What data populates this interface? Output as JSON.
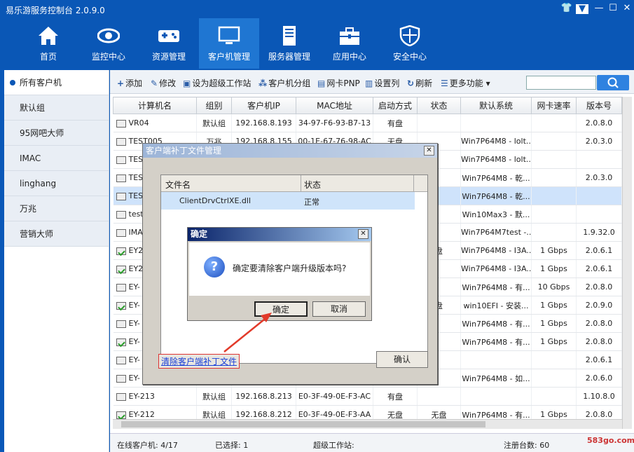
{
  "app": {
    "title": "易乐游服务控制台 2.0.9.0"
  },
  "nav": [
    {
      "label": "首页",
      "icon": "home-icon"
    },
    {
      "label": "监控中心",
      "icon": "eye-icon"
    },
    {
      "label": "资源管理",
      "icon": "gamepad-icon"
    },
    {
      "label": "客户机管理",
      "icon": "monitor-icon"
    },
    {
      "label": "服务器管理",
      "icon": "server-icon"
    },
    {
      "label": "应用中心",
      "icon": "toolbox-icon"
    },
    {
      "label": "安全中心",
      "icon": "shield-icon"
    }
  ],
  "sidebar": {
    "items": [
      {
        "label": "所有客户机"
      },
      {
        "label": "默认组"
      },
      {
        "label": "95网吧大师"
      },
      {
        "label": "IMAC"
      },
      {
        "label": "linghang"
      },
      {
        "label": "万兆"
      },
      {
        "label": "营销大师"
      }
    ]
  },
  "toolbar": {
    "add": "添加",
    "edit": "修改",
    "superws": "设为超级工作站",
    "group": "客户机分组",
    "pnp": "网卡PNP",
    "columns": "设置列",
    "refresh": "刷新",
    "more": "更多功能"
  },
  "table": {
    "headers": [
      "计算机名",
      "组别",
      "客户机IP",
      "MAC地址",
      "启动方式",
      "状态",
      "默认系统",
      "网卡速率",
      "版本号"
    ],
    "rows": [
      [
        "VR04",
        "默认组",
        "192.168.8.193",
        "34-97-F6-93-B7-13",
        "有盘",
        "",
        "",
        "",
        "2.0.8.0"
      ],
      [
        "TEST005",
        "万兆",
        "192.168.8.155",
        "00-1E-67-76-98-AC",
        "无盘",
        "",
        "Win7P64M8 - lolt...",
        "",
        "2.0.3.0"
      ],
      [
        "TES",
        "",
        "",
        "",
        "",
        "",
        "Win7P64M8 - lolt...",
        "",
        ""
      ],
      [
        "TES",
        "",
        "",
        "",
        "",
        "",
        "Win7P64M8 - 乾...",
        "",
        "2.0.3.0"
      ],
      [
        "TES",
        "",
        "",
        "",
        "",
        "",
        "Win7P64M8 - 乾...",
        "",
        ""
      ],
      [
        "test",
        "",
        "",
        "",
        "",
        "",
        "Win10Max3 - 默...",
        "",
        ""
      ],
      [
        "IMA",
        "",
        "",
        "",
        "",
        "",
        "Win7P64M7test -...",
        "",
        "1.9.32.0"
      ],
      [
        "EY2",
        "",
        "",
        "",
        "",
        "盘",
        "Win7P64M8 - I3A...",
        "1 Gbps",
        "2.0.6.1"
      ],
      [
        "EY2",
        "",
        "",
        "",
        "",
        "",
        "Win7P64M8 - I3A...",
        "1 Gbps",
        "2.0.6.1"
      ],
      [
        "EY-",
        "",
        "",
        "",
        "",
        "",
        "Win7P64M8 - 有...",
        "10 Gbps",
        "2.0.8.0"
      ],
      [
        "EY-",
        "",
        "",
        "",
        "",
        "盘",
        "win10EFI - 安装...",
        "1 Gbps",
        "2.0.9.0"
      ],
      [
        "EY-",
        "",
        "",
        "",
        "",
        "",
        "Win7P64M8 - 有...",
        "1 Gbps",
        "2.0.8.0"
      ],
      [
        "EY-",
        "",
        "",
        "",
        "",
        "",
        "Win7P64M8 - 有...",
        "1 Gbps",
        "2.0.8.0"
      ],
      [
        "EY-",
        "",
        "",
        "",
        "",
        "",
        "",
        "",
        "2.0.6.1"
      ],
      [
        "EY-",
        "",
        "",
        "",
        "",
        "",
        "Win7P64M8 - 如...",
        "",
        "2.0.6.0"
      ],
      [
        "EY-213",
        "默认组",
        "192.168.8.213",
        "E0-3F-49-0E-F3-AC",
        "有盘",
        "",
        "",
        "",
        "1.10.8.0"
      ],
      [
        "EY-212",
        "默认组",
        "192.168.8.212",
        "E0-3F-49-0E-F3-AA",
        "无盘",
        "无盘",
        "Win7P64M8 - 有...",
        "1 Gbps",
        "2.0.8.0"
      ]
    ],
    "online_rows": [
      7,
      8,
      10,
      12,
      16
    ]
  },
  "status": {
    "online": "在线客户机: 4/17",
    "selected": "已选择: 1",
    "superws": "超级工作站:",
    "registered": "注册台数: 60"
  },
  "patch_dialog": {
    "title": "客户端补丁文件管理",
    "col_file": "文件名",
    "col_status": "状态",
    "file_name": "ClientDrvCtrlXE.dll",
    "file_status": "正常",
    "clear_link": "清除客户端补丁文件",
    "confirm_label": "确认"
  },
  "confirm_dialog": {
    "title": "确定",
    "message": "确定要清除客户端升级版本吗?",
    "ok": "确定",
    "cancel": "取消"
  },
  "watermark": "583go.com",
  "colors": {
    "primary": "#0a57b6",
    "nav_active": "#1f76d2",
    "selection": "#cfe3fb",
    "arrow": "#e23a2a"
  }
}
